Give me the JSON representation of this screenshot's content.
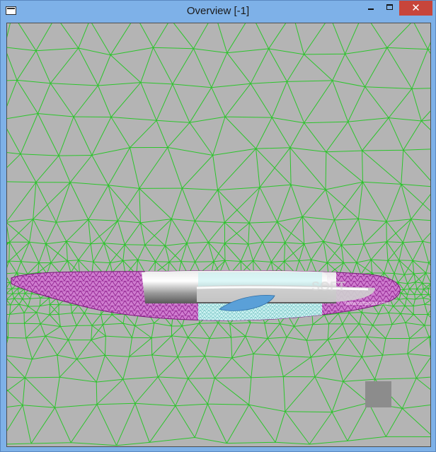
{
  "window": {
    "title": "Overview [-1]",
    "close_glyph": "✕",
    "icon": "window-app-icon"
  },
  "viewport": {
    "background_color": "#b4b4b4",
    "mesh_color": "#2cc52c",
    "body_mesh_color": "#9a1d9a",
    "body_surface_color": "#c8c8c8",
    "cutaway_color": "#9fe3e3",
    "wing_color": "#5aa0d8",
    "watermark_text": "SOFT",
    "watermark_url": "www.softpedia.com"
  }
}
